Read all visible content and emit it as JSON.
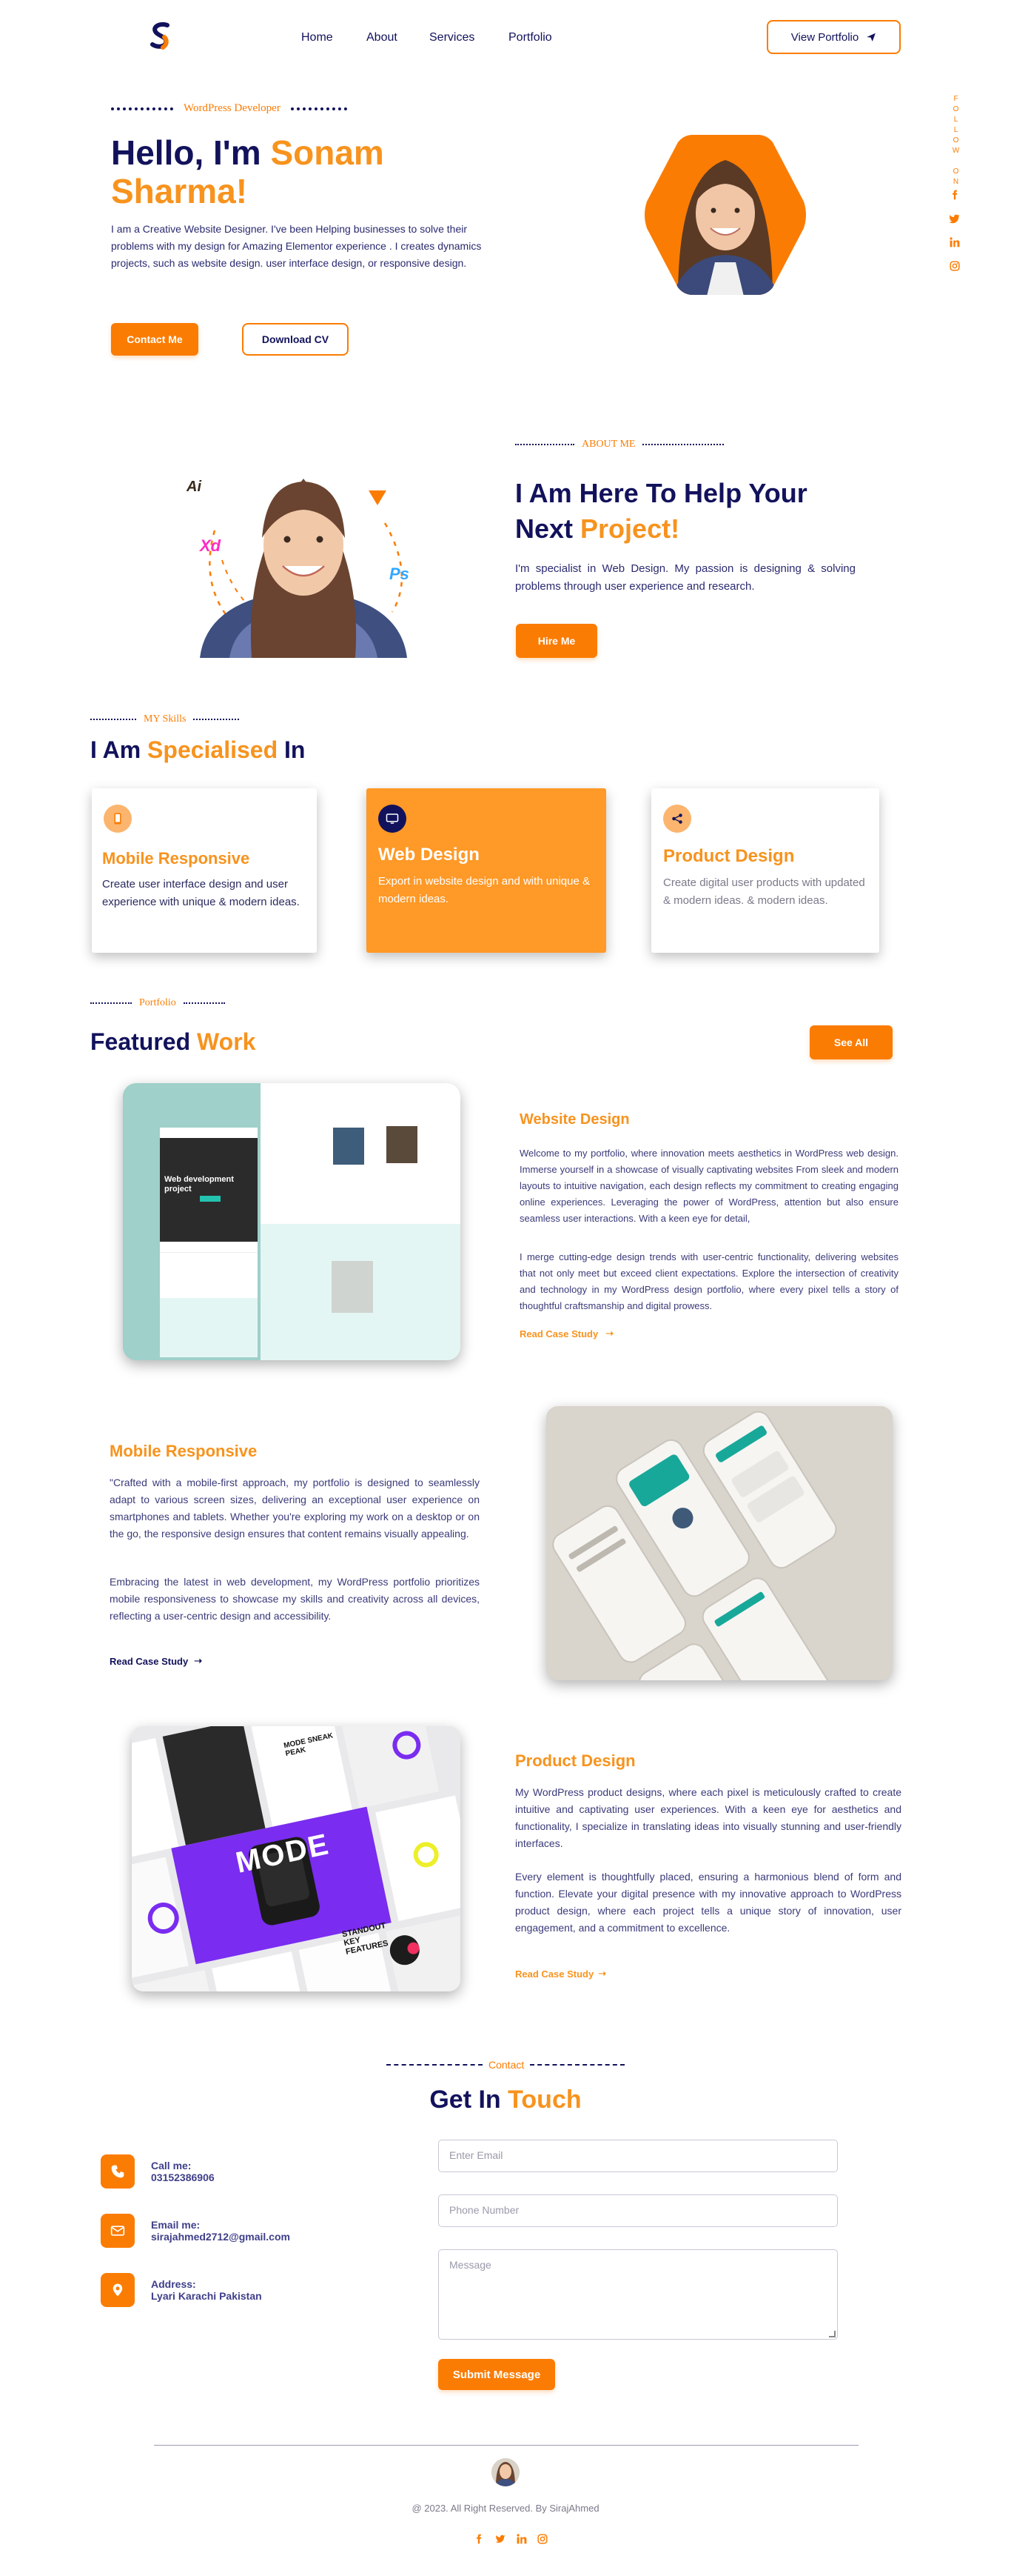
{
  "nav": {
    "logo": "S",
    "links": [
      "Home",
      "About",
      "Services",
      "Portfolio"
    ],
    "cta": "View Portfolio"
  },
  "follow": {
    "label": "FOLLOW ON",
    "icons": [
      "facebook-icon",
      "twitter-icon",
      "linkedin-icon",
      "instagram-icon"
    ]
  },
  "hero": {
    "eyebrow": "WordPress Developer",
    "title_prefix": "Hello, I'm ",
    "title_name_1": "Sonam",
    "title_name_2": "Sharma!",
    "description": "I am a Creative  Website Designer. I've been Helping businesses to solve their problems with my design for  Amazing Elementor experience . I creates dynamics projects, such as website design. user interface design, or responsive design.",
    "contact_btn": "Contact Me",
    "download_btn": "Download CV"
  },
  "about": {
    "eyebrow": "ABOUT ME",
    "title_line1": "I Am Here To Help Your",
    "title_line2_a": "Next ",
    "title_line2_b": "Project!",
    "description": "I'm specialist in Web Design. My passion is designing & solving problems through user experience and research.",
    "hire_btn": "Hire Me",
    "tools": [
      "Ai",
      "Xd",
      "Ps"
    ]
  },
  "skills": {
    "eyebrow": "MY Skills",
    "title_a": "I Am ",
    "title_b": "Specialised",
    "title_c": " In",
    "cards": [
      {
        "icon": "phone-icon",
        "title": "Mobile Responsive",
        "text": "Create user interface design and user experience with unique & modern ideas."
      },
      {
        "icon": "monitor-icon",
        "title": "Web Design",
        "text": "Export in website design and with unique & modern ideas."
      },
      {
        "icon": "share-icon",
        "title": "Product Design",
        "text": "Create digital user products with updated & modern ideas. & modern ideas."
      }
    ]
  },
  "portfolio": {
    "eyebrow": "Portfolio",
    "title_a": "Featured ",
    "title_b": "Work",
    "see_all": "See All",
    "mock_hero_text": "Web development project",
    "items": [
      {
        "title": "Website Design",
        "p1": "Welcome to my portfolio, where innovation meets aesthetics in WordPress web design. Immerse yourself in a showcase of visually captivating websites From sleek and modern layouts to intuitive navigation, each design reflects my commitment to creating engaging online experiences. Leveraging the power of WordPress, attention but also ensure seamless user interactions. With a keen eye for detail,",
        "p2": "I merge cutting-edge design trends with user-centric functionality, delivering websites that not only meet but exceed client expectations. Explore the intersection of creativity and technology in my WordPress design portfolio, where every pixel tells a story of thoughtful craftsmanship and digital prowess.",
        "link": "Read Case Study"
      },
      {
        "title": "Mobile Responsive",
        "p1": "\"Crafted with a mobile-first approach, my portfolio is designed to seamlessly adapt to various screen sizes, delivering an exceptional user experience on smartphones and tablets. Whether you're exploring my work on a desktop or on the go, the responsive design ensures that content remains visually appealing.",
        "p2": "Embracing the latest in web development, my WordPress portfolio prioritizes mobile responsiveness to showcase my skills and creativity across all devices, reflecting a user-centric design and accessibility.",
        "link": "Read Case Study"
      },
      {
        "title": "Product Design",
        "p1": "My WordPress product designs, where each pixel is meticulously crafted to create intuitive and captivating user experiences. With a keen eye for aesthetics and functionality, I specialize in translating ideas into visually stunning and user-friendly interfaces.",
        "p2": "Every element is thoughtfully placed, ensuring a harmonious blend of form and function. Elevate your digital presence with my innovative approach to WordPress product design, where each project tells a unique story of innovation, user engagement, and a commitment to excellence.",
        "link": "Read Case Study"
      }
    ],
    "product_mock": {
      "brand": "MODE",
      "tag1": "MODE SNEAK PEAK",
      "tag2": "STANDOUT KEY FEATURES"
    }
  },
  "contact": {
    "eyebrow": "Contact",
    "title_a": "Get In ",
    "title_b": "Touch",
    "items": [
      {
        "icon": "phone-icon",
        "label": "Call me:",
        "value": "03152386906"
      },
      {
        "icon": "mail-icon",
        "label": "Email me:",
        "value": "sirajahmed2712@gmail.com"
      },
      {
        "icon": "location-icon",
        "label": "Address:",
        "value": "Lyari Karachi Pakistan"
      }
    ],
    "email_placeholder": "Enter Email",
    "phone_placeholder": "Phone Number",
    "message_placeholder": "Message",
    "submit": "Submit Message"
  },
  "footer": {
    "copyright": "@ 2023. All Right Reserved. By SirajAhmed",
    "icons": [
      "facebook-icon",
      "twitter-icon",
      "linkedin-icon",
      "instagram-icon"
    ]
  },
  "colors": {
    "navy": "#12125c",
    "orange": "#f7931e",
    "button_orange": "#fb7c03"
  }
}
